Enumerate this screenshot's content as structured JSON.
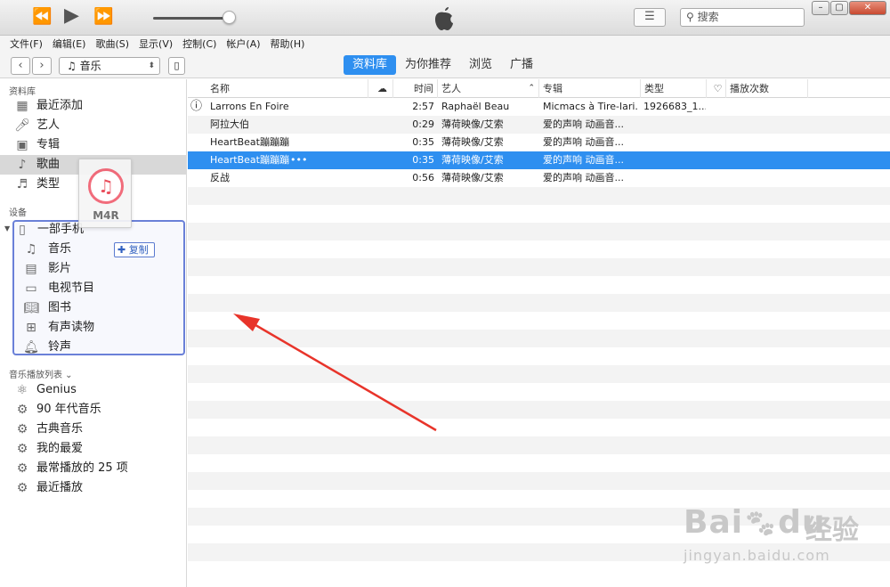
{
  "search": {
    "placeholder": "搜索"
  },
  "menu": [
    "文件(F)",
    "编辑(E)",
    "歌曲(S)",
    "显示(V)",
    "控制(C)",
    "帐户(A)",
    "帮助(H)"
  ],
  "nav": {
    "media_selector": "音乐",
    "tabs": [
      {
        "label": "资料库",
        "active": true
      },
      {
        "label": "为你推荐",
        "active": false
      },
      {
        "label": "浏览",
        "active": false
      },
      {
        "label": "广播",
        "active": false
      }
    ]
  },
  "sidebar": {
    "library_title": "资料库",
    "library_items": [
      {
        "label": "最近添加",
        "icon": "grid-icon"
      },
      {
        "label": "艺人",
        "icon": "microphone-icon"
      },
      {
        "label": "专辑",
        "icon": "album-icon"
      },
      {
        "label": "歌曲",
        "icon": "note-icon",
        "selected": true
      },
      {
        "label": "类型",
        "icon": "genre-icon"
      }
    ],
    "devices_title": "设备",
    "device_name": "一部手机",
    "device_items": [
      {
        "label": "音乐",
        "icon": "note-icon"
      },
      {
        "label": "影片",
        "icon": "film-icon"
      },
      {
        "label": "电视节目",
        "icon": "tv-icon"
      },
      {
        "label": "图书",
        "icon": "book-icon"
      },
      {
        "label": "有声读物",
        "icon": "audiobook-icon"
      },
      {
        "label": "铃声",
        "icon": "bell-icon"
      }
    ],
    "playlists_title": "音乐播放列表 ⌄",
    "playlists": [
      {
        "label": "Genius",
        "icon": "atom-icon"
      },
      {
        "label": "90 年代音乐",
        "icon": "gear-icon"
      },
      {
        "label": "古典音乐",
        "icon": "gear-icon"
      },
      {
        "label": "我的最爱",
        "icon": "gear-icon"
      },
      {
        "label": "最常播放的 25 项",
        "icon": "gear-icon"
      },
      {
        "label": "最近播放",
        "icon": "gear-icon"
      }
    ]
  },
  "drag": {
    "file_label": "M4R",
    "copy_label": "复制"
  },
  "table": {
    "headers": {
      "name": "名称",
      "time": "时间",
      "artist": "艺人",
      "album": "专辑",
      "kind": "类型",
      "plays": "播放次数"
    },
    "rows": [
      {
        "alert": true,
        "name": "Larrons En Foire",
        "time": "2:57",
        "artist": "Raphaël Beau",
        "album": "Micmacs à Tire-lari...",
        "kind": "1926683_1...",
        "selected": false
      },
      {
        "alert": false,
        "name": "阿拉大伯",
        "time": "0:29",
        "artist": "薄荷映像/艾索",
        "album": "爱的声响 动画音...",
        "kind": "",
        "selected": false
      },
      {
        "alert": false,
        "name": "HeartBeat蹦蹦蹦",
        "time": "0:35",
        "artist": "薄荷映像/艾索",
        "album": "爱的声响 动画音...",
        "kind": "",
        "selected": false
      },
      {
        "alert": false,
        "name": "HeartBeat蹦蹦蹦",
        "more": "•••",
        "time": "0:35",
        "artist": "薄荷映像/艾索",
        "album": "爱的声响 动画音...",
        "kind": "",
        "selected": true
      },
      {
        "alert": false,
        "name": "反战",
        "time": "0:56",
        "artist": "薄荷映像/艾索",
        "album": "爱的声响 动画音...",
        "kind": "",
        "selected": false
      }
    ]
  },
  "watermark": {
    "brand": "Bai",
    "brand2": "du",
    "brand_cn": "经验",
    "url": "jingyan.baidu.com"
  },
  "colors": {
    "accent": "#2e8ff0",
    "device_box": "#6a80d8",
    "arrow": "#e8342a"
  }
}
